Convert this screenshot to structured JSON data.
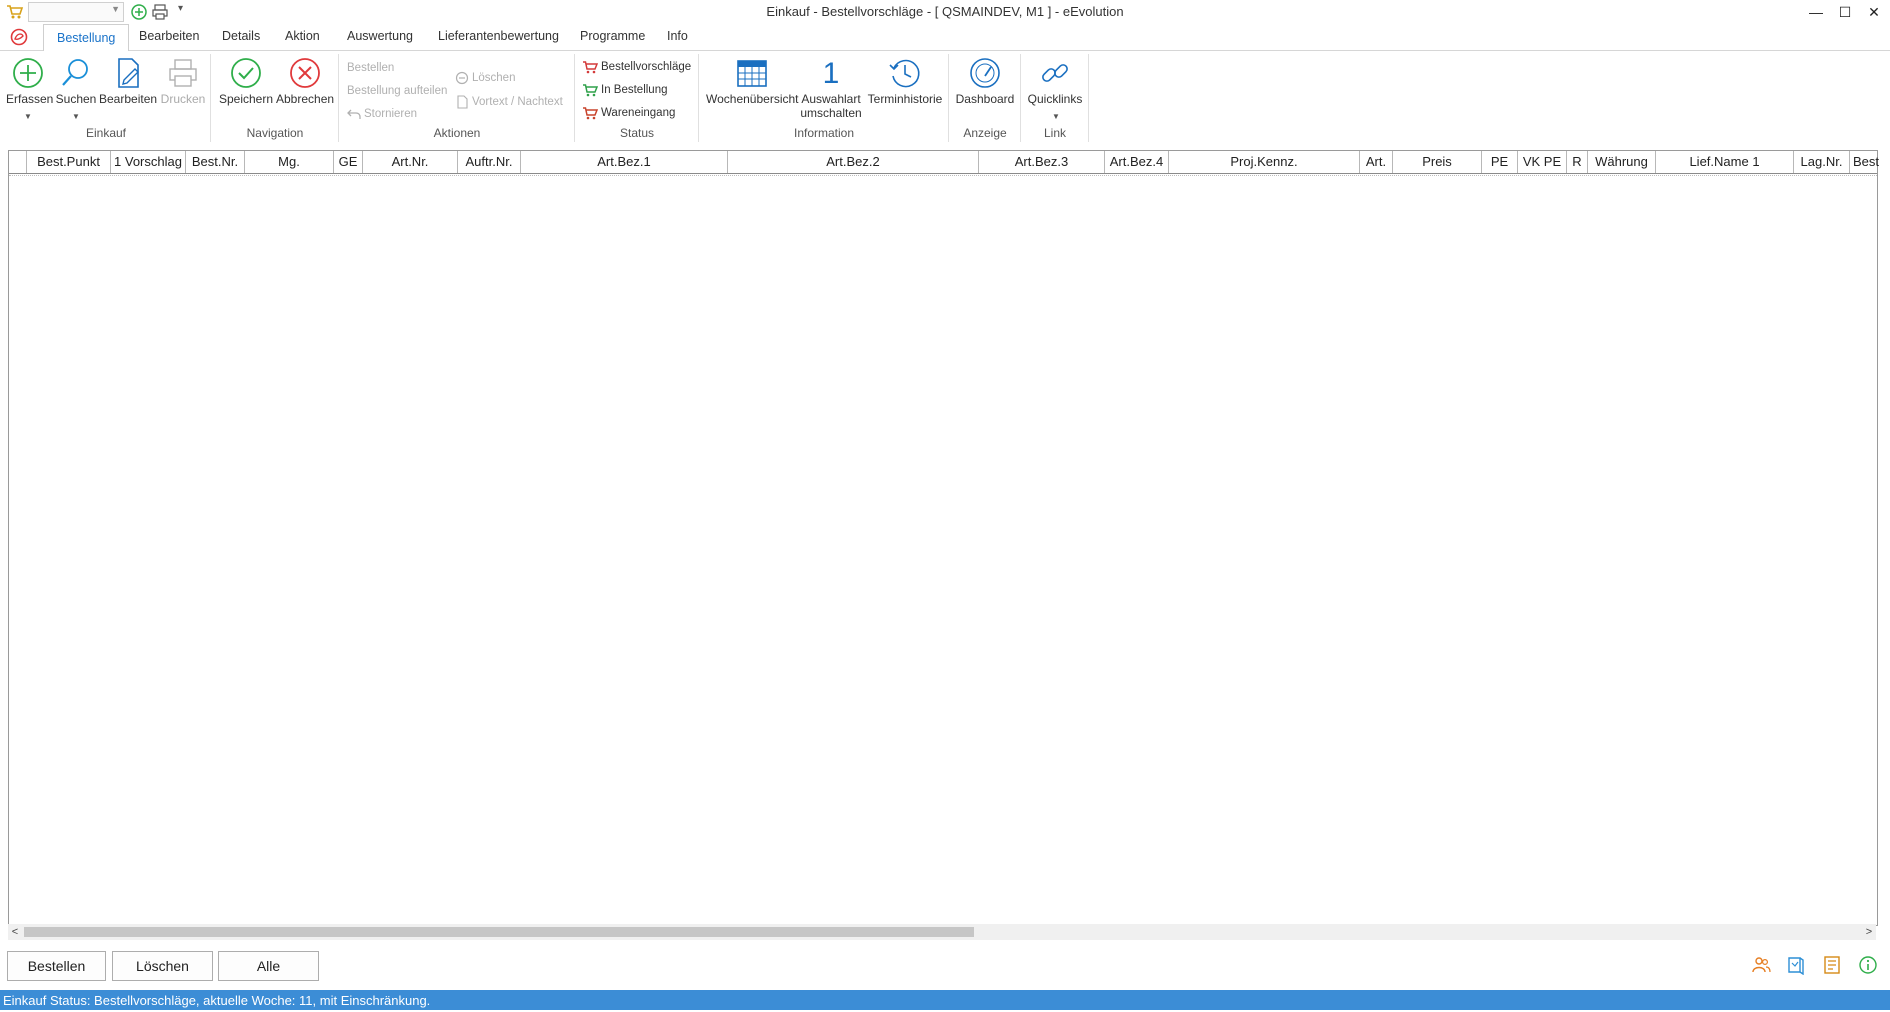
{
  "window": {
    "title": "Einkauf - Bestellvorschläge - [ QSMAINDEV, M1 ]  -  eEvolution",
    "minimize": "—",
    "maximize": "☐",
    "close": "✕"
  },
  "quick_access": {
    "combo_value": ""
  },
  "tabs": [
    "Bestellung",
    "Bearbeiten",
    "Details",
    "Aktion",
    "Auswertung",
    "Lieferantenbewertung",
    "Programme",
    "Info"
  ],
  "ribbon": {
    "einkauf": {
      "label": "Einkauf",
      "erfassen": "Erfassen",
      "suchen": "Suchen",
      "bearbeiten": "Bearbeiten",
      "drucken": "Drucken"
    },
    "navigation": {
      "label": "Navigation",
      "speichern": "Speichern",
      "abbrechen": "Abbrechen"
    },
    "aktionen": {
      "label": "Aktionen",
      "bestellen": "Bestellen",
      "aufteilen": "Bestellung aufteilen",
      "stornieren": "Stornieren",
      "loeschen": "Löschen",
      "vortext": "Vortext / Nachtext"
    },
    "status": {
      "label": "Status",
      "vorschlaege": "Bestellvorschläge",
      "in_bestellung": "In Bestellung",
      "wareneingang": "Wareneingang"
    },
    "information": {
      "label": "Information",
      "wochen": "Wochenübersicht",
      "auswahlart_1": "Auswahlart",
      "auswahlart_2": "umschalten",
      "auswahlart_num": "1",
      "termin": "Terminhistorie"
    },
    "anzeige": {
      "label": "Anzeige",
      "dashboard": "Dashboard"
    },
    "link": {
      "label": "Link",
      "quicklinks": "Quicklinks"
    }
  },
  "grid": {
    "columns": [
      "",
      "Best.Punkt",
      "1 Vorschlag",
      "Best.Nr.",
      "Mg.",
      "GE",
      "Art.Nr.",
      "Auftr.Nr.",
      "Art.Bez.1",
      "Art.Bez.2",
      "Art.Bez.3",
      "Art.Bez.4",
      "Proj.Kennz.",
      "Art.",
      "Preis",
      "PE",
      "VK PE",
      "R",
      "Währung",
      "Lief.Name 1",
      "Lag.Nr.",
      "Best.A"
    ],
    "rows": []
  },
  "scrollbar": {
    "left": "<",
    "right": ">"
  },
  "buttons": {
    "bestellen": "Bestellen",
    "loeschen": "Löschen",
    "alle": "Alle"
  },
  "status": {
    "text": "Einkauf Status: Bestellvorschläge, aktuelle Woche: 11, mit Einschränkung."
  },
  "colors": {
    "accent": "#1a73c9",
    "statusbar": "#3c8dd6",
    "ok_green": "#2fae4a",
    "cancel_red": "#e0393b"
  }
}
